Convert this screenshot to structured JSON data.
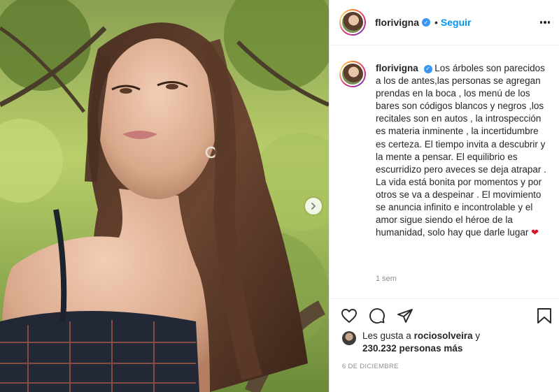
{
  "header": {
    "username": "florivigna",
    "verified_mark": "✓",
    "separator": "•",
    "follow_label": "Seguir",
    "more_icon": "more-dots-icon"
  },
  "caption": {
    "username": "florivigna",
    "verified_mark": "✓",
    "text": "Los árboles son parecidos a los de antes,las personas se agregan prendas en la boca , los menú de los bares son códigos blancos y negros ,los recitales son en autos , la introspección es materia inminente , la incertidumbre es certeza. El tiempo invita a descubrir y la mente a pensar. El equilibrio es escurridizo pero aveces se deja atrapar . La vida está bonita por momentos y por otros se va a despeinar . El movimiento se anuncia infinito e incontrolable y el amor sigue siendo el héroe de la humanidad, solo hay que darle lugar",
    "emoji": "❤",
    "time_ago": "1 sem"
  },
  "actions": {
    "like_icon": "heart-icon",
    "comment_icon": "comment-icon",
    "share_icon": "share-icon",
    "save_icon": "bookmark-icon"
  },
  "likes": {
    "prefix": "Les gusta a",
    "user": "rociosolveira",
    "connector": "y",
    "count": "230.232 personas más"
  },
  "post_date": "6 DE DICIEMBRE",
  "media": {
    "next_icon": "chevron-right-icon"
  },
  "colors": {
    "link_blue": "#0095f6",
    "verified_blue": "#3897f0",
    "secondary_text": "#8e8e8e",
    "border": "#efefef"
  }
}
